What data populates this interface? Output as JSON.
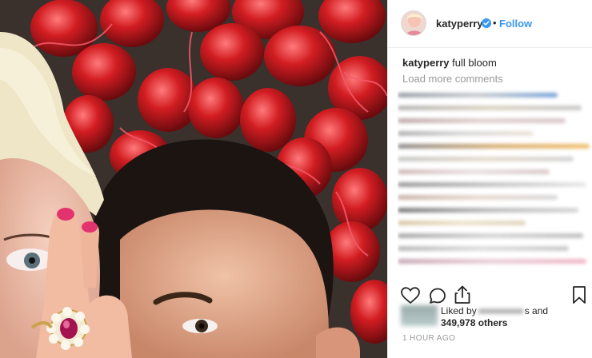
{
  "post": {
    "username": "katyperry",
    "follow_label": "Follow",
    "dot": "•",
    "caption_user": "katyperry",
    "caption_text": " full bloom",
    "load_more": "Load more comments",
    "likes_prefix": "Liked by",
    "likes_suffix": "s and",
    "likes_count": "349,978 others",
    "time": "1 HOUR AGO"
  },
  "icons": {
    "verified": "verified-badge-icon",
    "like": "heart-icon",
    "comment": "comment-icon",
    "share": "share-icon",
    "save": "bookmark-icon"
  },
  "colors": {
    "accent": "#3897f0",
    "text": "#262626",
    "muted": "#999999"
  }
}
